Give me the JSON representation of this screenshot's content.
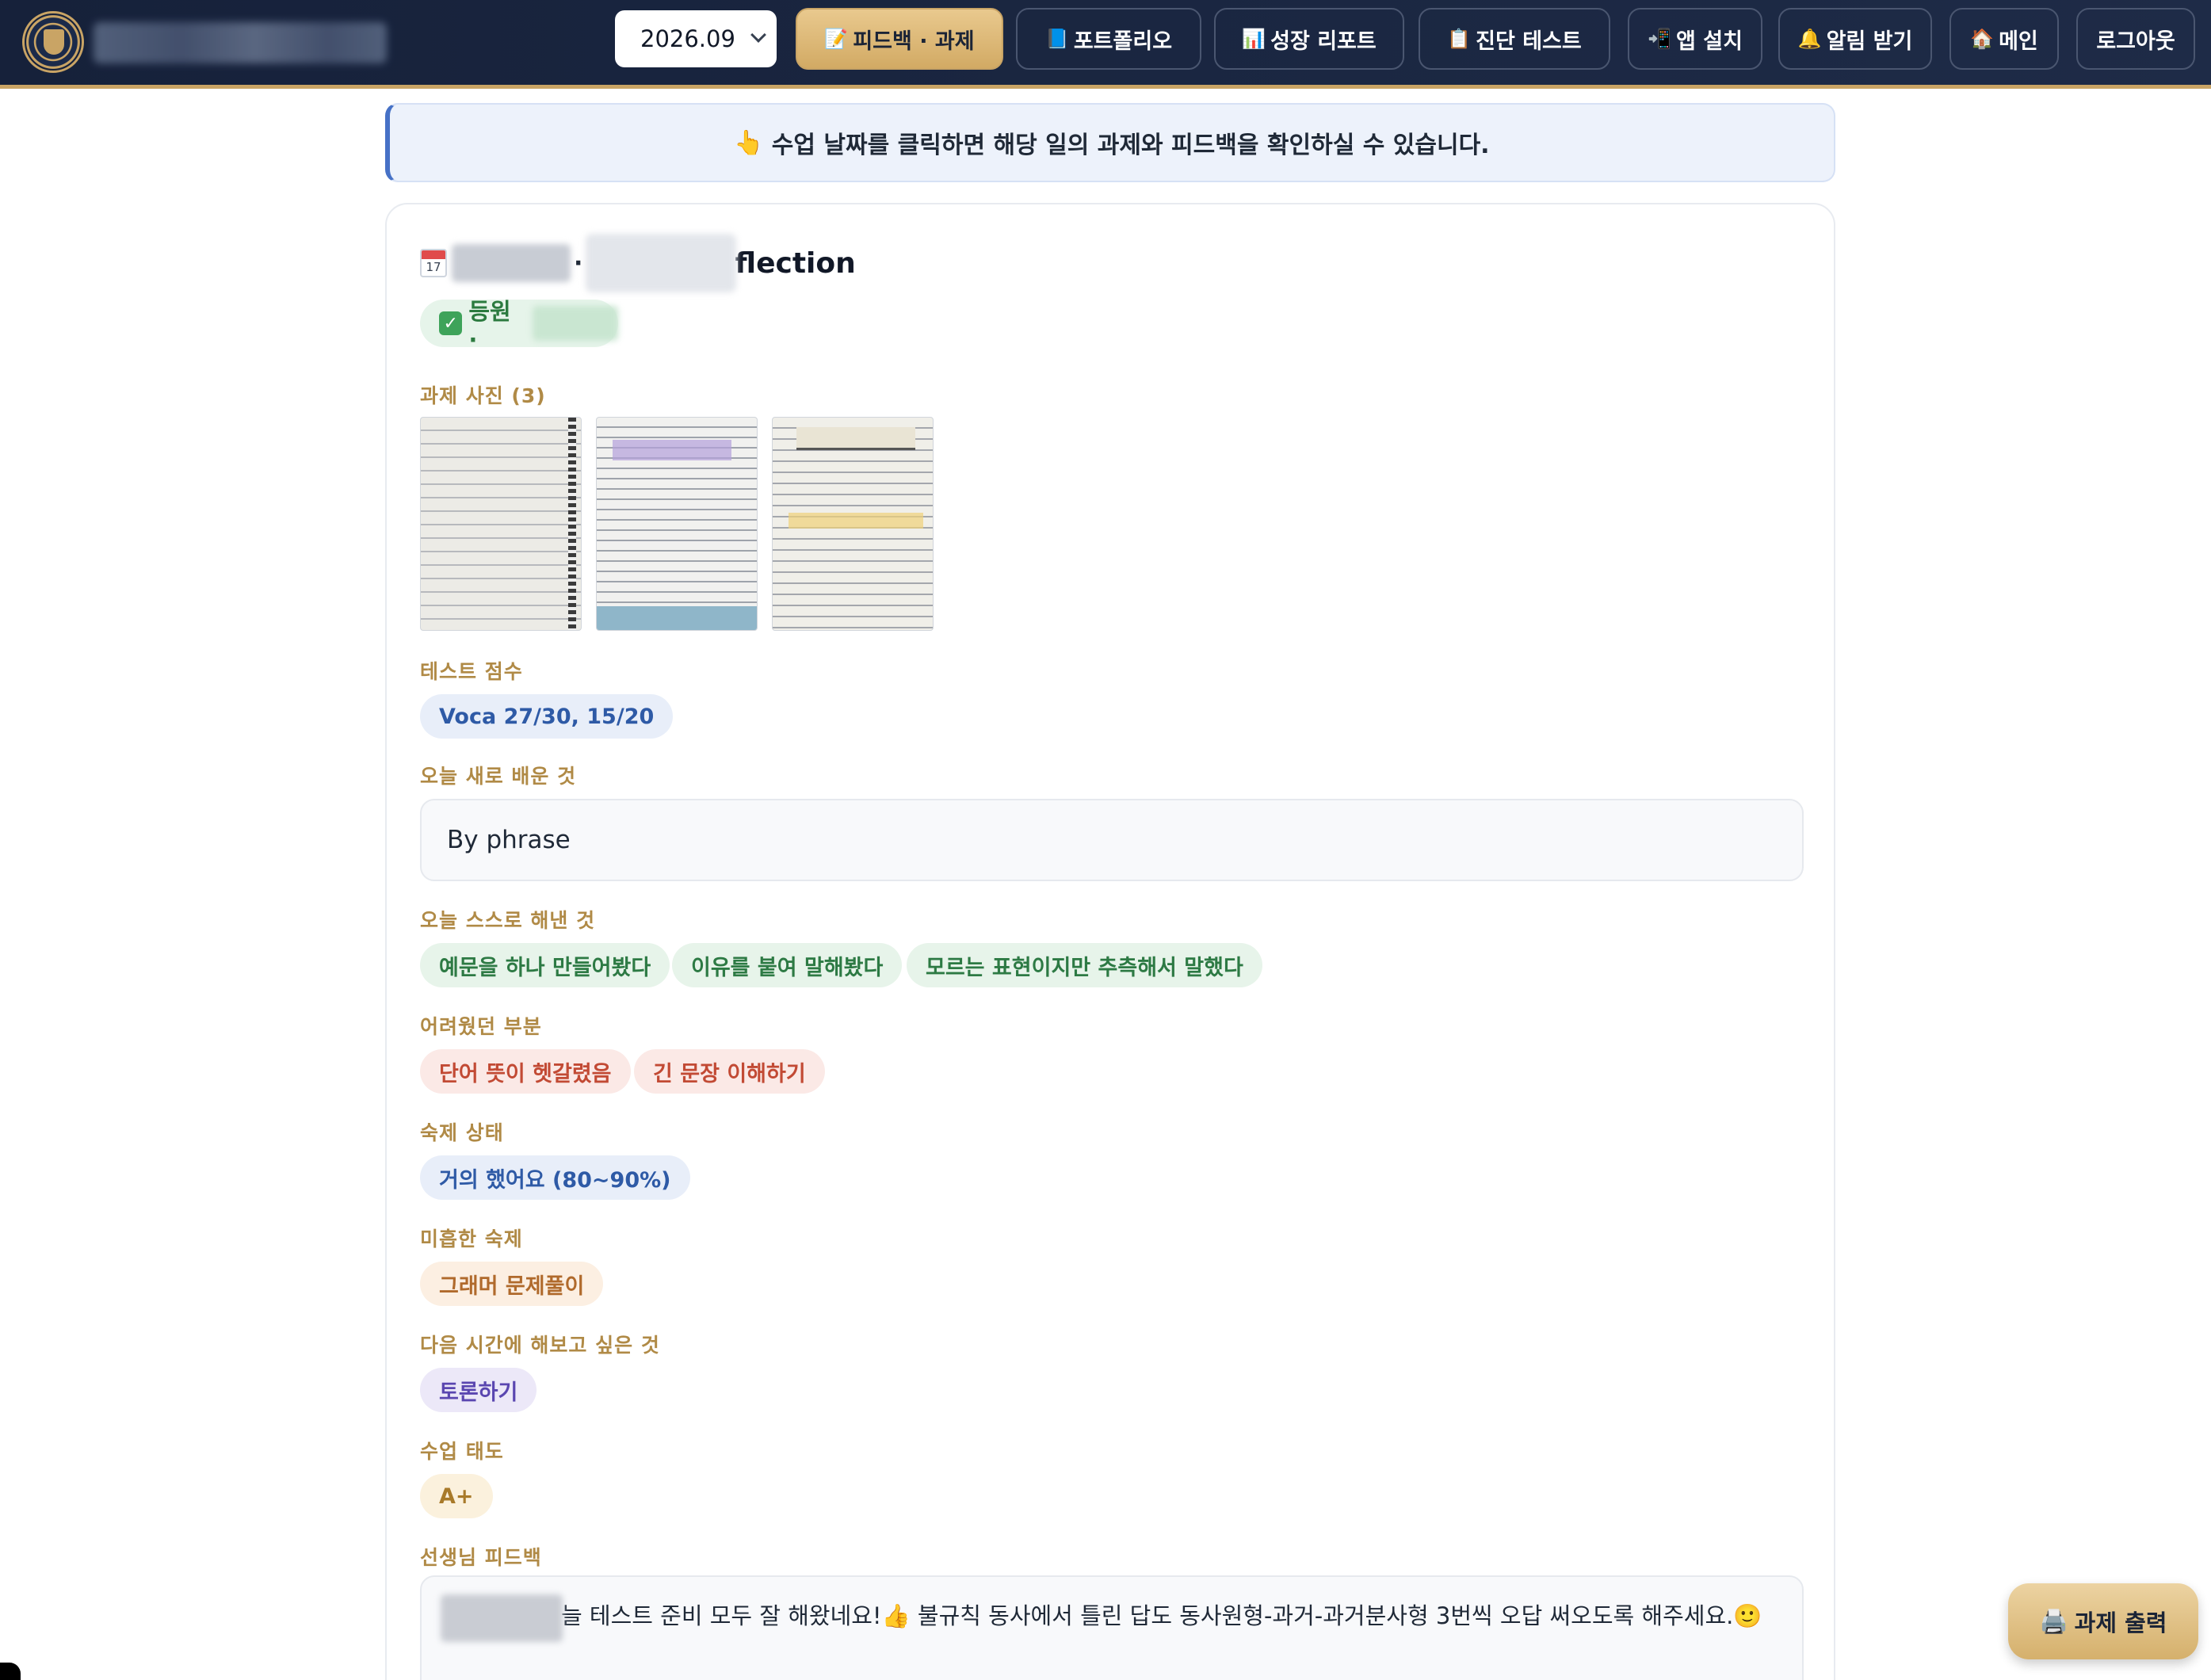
{
  "header": {
    "month": "2026.09",
    "nav": [
      {
        "icon": "memo-icon",
        "glyph": "📝",
        "label": "피드백 · 과제",
        "active": true
      },
      {
        "icon": "book-icon",
        "glyph": "📘",
        "label": "포트폴리오"
      },
      {
        "icon": "chart-icon",
        "glyph": "📊",
        "label": "성장 리포트"
      },
      {
        "icon": "clipboard-icon",
        "glyph": "📋",
        "label": "진단 테스트"
      },
      {
        "icon": "install-icon",
        "glyph": "📲",
        "label": "앱 설치"
      },
      {
        "icon": "bell-icon",
        "glyph": "🔔",
        "label": "알림 받기"
      },
      {
        "icon": "home-icon",
        "glyph": "🏠",
        "label": "메인"
      },
      {
        "label": "로그아웃"
      }
    ]
  },
  "notice": {
    "icon": "pointing-hand-icon",
    "glyph": "👆",
    "text": "수업 날짜를 클릭하면 해당 일의 과제와 피드백을 확인하실 수 있습니다."
  },
  "entry": {
    "calendar_day": "17",
    "title_tail": "flection",
    "attendance": "등원 ·",
    "photos_label": "과제 사진 (3)",
    "test_label": "테스트 점수",
    "test_score": "Voca 27/30, 15/20",
    "learned_label": "오늘 새로 배운 것",
    "learned_text": "By phrase",
    "self_label": "오늘 스스로 해낸 것",
    "self_items": [
      "예문을 하나 만들어봤다",
      "이유를 붙여 말해봤다",
      "모르는 표현이지만 추측해서 말했다"
    ],
    "hard_label": "어려웠던 부분",
    "hard_items": [
      "단어 뜻이 헷갈렸음",
      "긴 문장 이해하기"
    ],
    "homework_label": "숙제 상태",
    "homework_status": "거의 했어요 (80~90%)",
    "lacking_label": "미흡한 숙제",
    "lacking_item": "그래머 문제풀이",
    "next_label": "다음 시간에 해보고 싶은 것",
    "next_item": "토론하기",
    "attitude_label": "수업 태도",
    "attitude_grade": "A+",
    "feedback_label": "선생님 피드백",
    "feedback_text": "늘 테스트 준비 모두 잘 해왔네요!👍 불규칙 동사에서 틀린 답도 동사원형-과거-과거분사형 3번씩 오답 써오도록 해주세요.🙂"
  },
  "print_button": {
    "icon": "printer-icon",
    "glyph": "🖨️",
    "label": "과제 출력"
  },
  "colors": {
    "navy": "#16213a",
    "gold": "#c9a465",
    "label_gold": "#b08a46",
    "notice_blue": "#4671c6"
  }
}
